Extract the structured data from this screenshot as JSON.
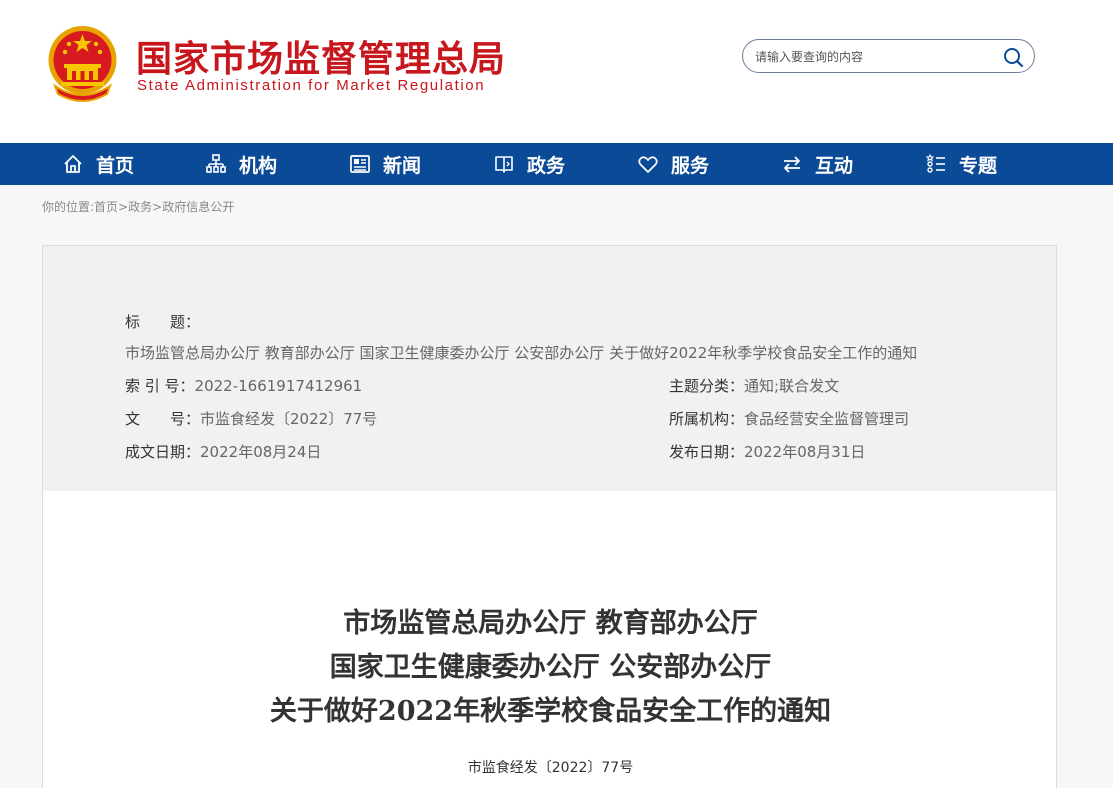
{
  "header": {
    "org_name_cn": "国家市场监督管理总局",
    "org_name_en": "State Administration for Market Regulation",
    "search_placeholder": "请输入要查询的内容"
  },
  "nav": {
    "items": [
      {
        "label": "首页",
        "icon": "home-icon"
      },
      {
        "label": "机构",
        "icon": "org-chart-icon"
      },
      {
        "label": "新闻",
        "icon": "newspaper-icon"
      },
      {
        "label": "政务",
        "icon": "book-icon"
      },
      {
        "label": "服务",
        "icon": "heart-icon"
      },
      {
        "label": "互动",
        "icon": "exchange-icon"
      },
      {
        "label": "专题",
        "icon": "list-icon"
      }
    ]
  },
  "breadcrumb": {
    "prefix": "你的位置:",
    "items": [
      "首页",
      "政务",
      "政府信息公开"
    ],
    "separator": ">"
  },
  "meta": {
    "title_label": "标　　题：",
    "title_value": "市场监管总局办公厅 教育部办公厅 国家卫生健康委办公厅 公安部办公厅 关于做好2022年秋季学校食品安全工作的通知",
    "index_label": "索 引 号：",
    "index_value": "2022-1661917412961",
    "category_label": "主题分类：",
    "category_value": "通知;联合发文",
    "docnum_label": "文　　号：",
    "docnum_value": "市监食经发〔2022〕77号",
    "agency_label": "所属机构：",
    "agency_value": "食品经营安全监督管理司",
    "created_label": "成文日期：",
    "created_value": "2022年08月24日",
    "published_label": "发布日期：",
    "published_value": "2022年08月31日"
  },
  "document": {
    "title_lines": [
      "市场监管总局办公厅 教育部办公厅",
      "国家卫生健康委办公厅 公安部办公厅",
      "关于做好2022年秋季学校食品安全工作的通知"
    ],
    "doc_number": "市监食经发〔2022〕77号"
  },
  "colors": {
    "brand_red": "#c8161d",
    "nav_blue": "#0b4a96",
    "emblem_gold": "#f2b705"
  }
}
